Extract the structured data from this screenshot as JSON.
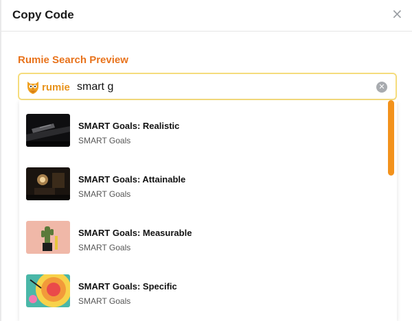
{
  "modal": {
    "title": "Copy Code",
    "close_icon": "×"
  },
  "section_label": "Rumie Search Preview",
  "search": {
    "logo_text": "rumie",
    "value": "smart g",
    "clear_icon": "✕"
  },
  "results": [
    {
      "title": "SMART Goals: Realistic",
      "subtitle": "SMART Goals",
      "thumb": "dark-piano"
    },
    {
      "title": "SMART Goals: Attainable",
      "subtitle": "SMART Goals",
      "thumb": "dim-room"
    },
    {
      "title": "SMART Goals: Measurable",
      "subtitle": "SMART Goals",
      "thumb": "cactus-pink"
    },
    {
      "title": "SMART Goals: Specific",
      "subtitle": "SMART Goals",
      "thumb": "colorful-target"
    }
  ],
  "colors": {
    "accent": "#e8731c",
    "search_border": "#f5dc7c",
    "scroll_thumb": "#f3921c"
  }
}
